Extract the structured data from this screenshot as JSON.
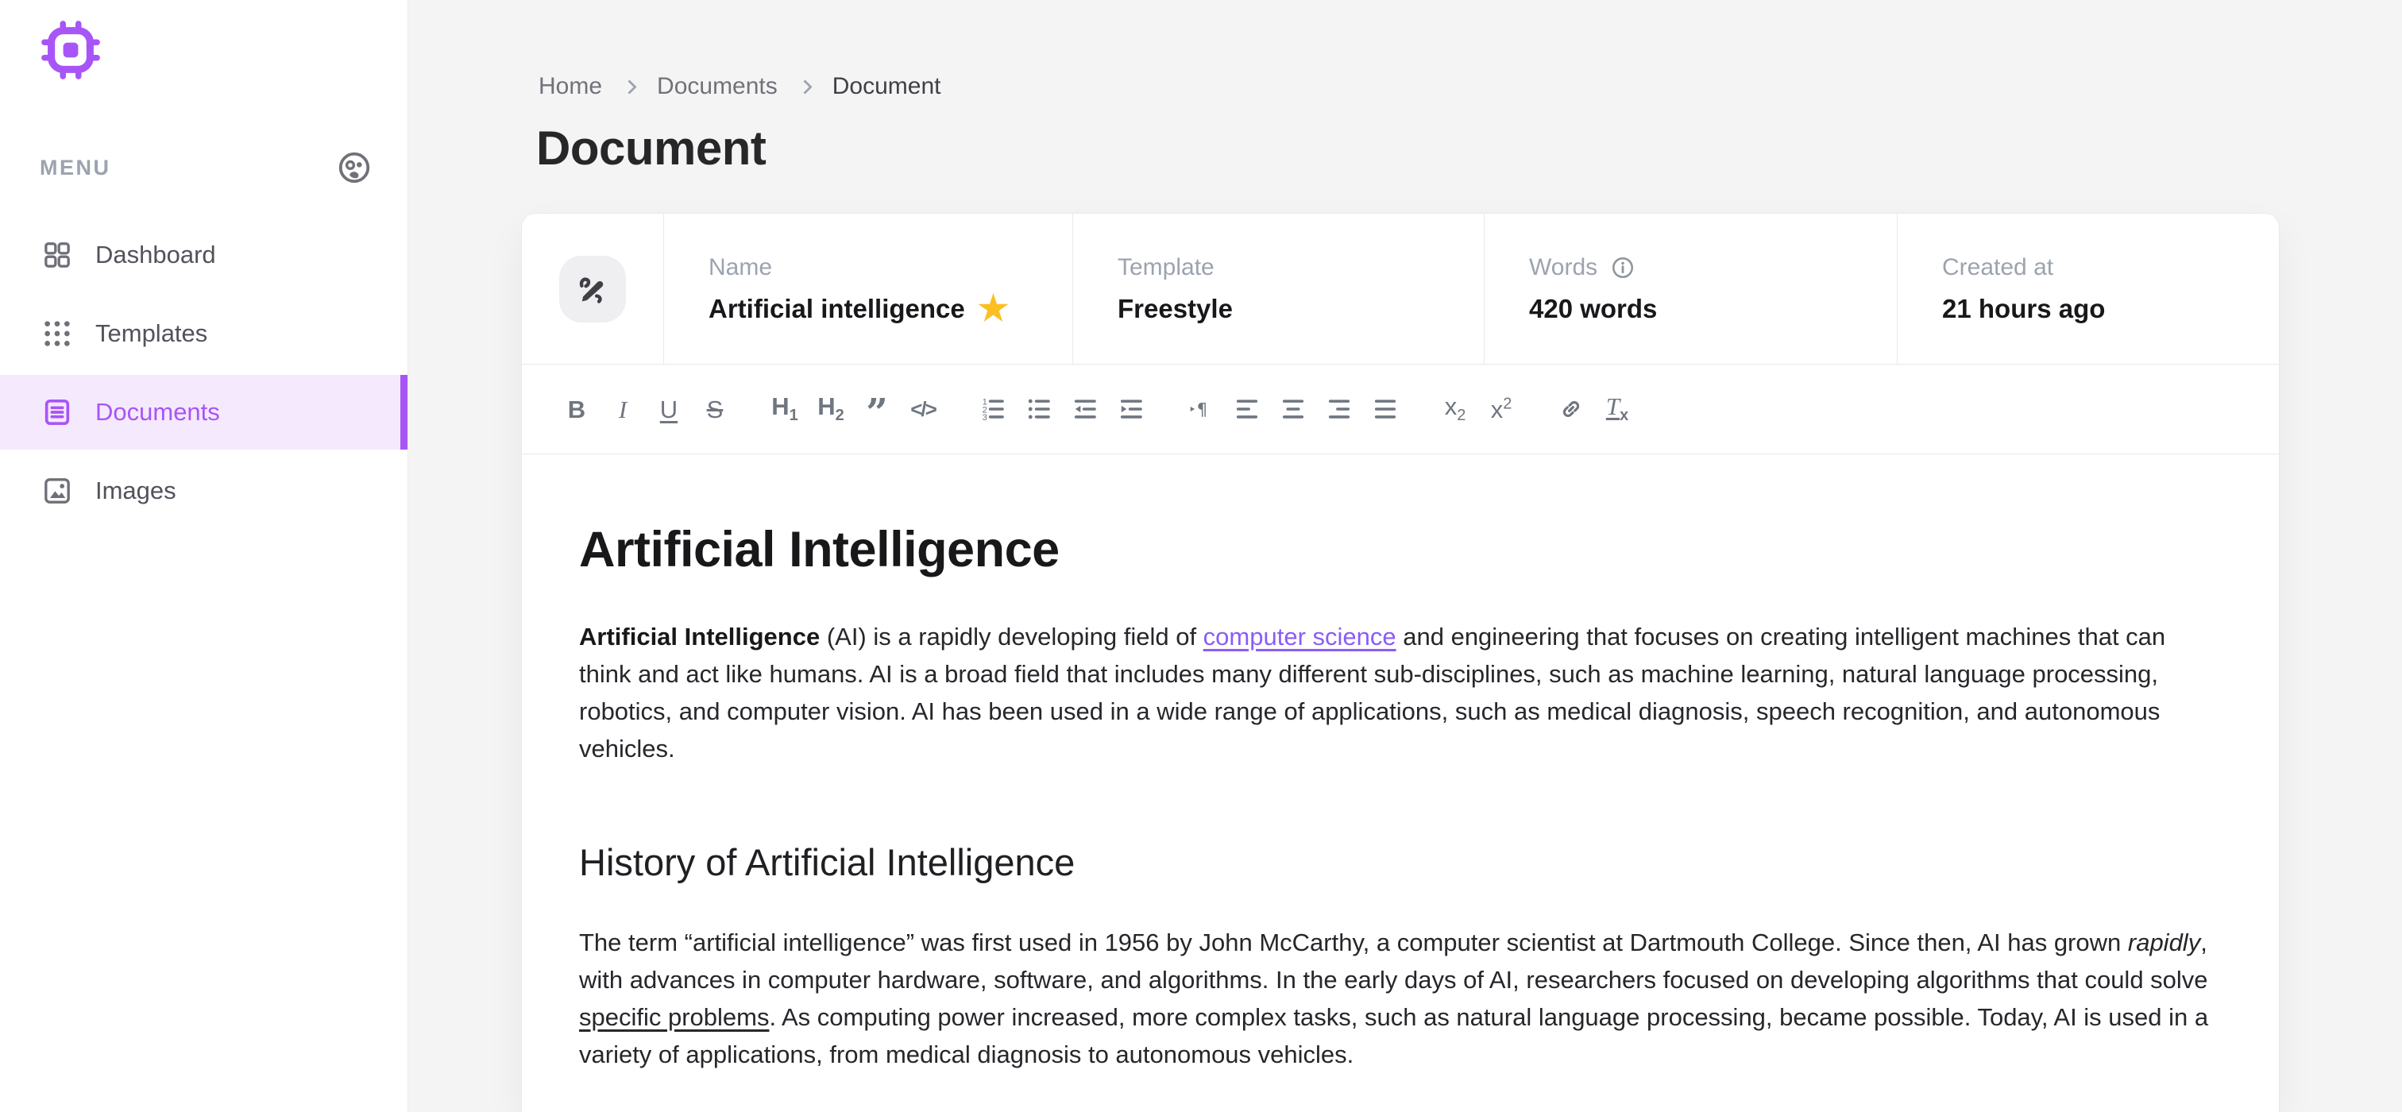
{
  "colors": {
    "accent": "#a855f7",
    "link": "#8b5cf6",
    "star": "#fbbf24",
    "active_item_bg": "#f5e9fd",
    "page_bg": "#f4f4f5"
  },
  "sidebar": {
    "menu_label": "MENU",
    "items": [
      {
        "label": "Dashboard",
        "icon": "dashboard-icon",
        "active": false
      },
      {
        "label": "Templates",
        "icon": "templates-icon",
        "active": false
      },
      {
        "label": "Documents",
        "icon": "documents-icon",
        "active": true
      },
      {
        "label": "Images",
        "icon": "images-icon",
        "active": false
      }
    ]
  },
  "header": {
    "breadcrumb": [
      {
        "label": "Home"
      },
      {
        "label": "Documents"
      },
      {
        "label": "Document"
      }
    ],
    "title": "Document",
    "actions": [
      "save-icon",
      "copy-icon",
      "more-icon"
    ]
  },
  "meta": {
    "fields": [
      {
        "label": "Name",
        "value": "Artificial intelligence",
        "starred": true
      },
      {
        "label": "Template",
        "value": "Freestyle"
      },
      {
        "label": "Words",
        "value": "420 words",
        "info": true
      },
      {
        "label": "Created at",
        "value": "21 hours ago"
      }
    ],
    "star_glyph": "★"
  },
  "toolbar": {
    "groups": [
      [
        "bold-icon",
        "italic-icon",
        "underline-icon",
        "strikethrough-icon"
      ],
      [
        "heading1-icon",
        "heading2-icon",
        "blockquote-icon",
        "code-icon"
      ],
      [
        "ordered-list-icon",
        "unordered-list-icon",
        "outdent-icon",
        "indent-icon"
      ],
      [
        "text-direction-icon",
        "align-left-icon",
        "align-center-icon",
        "align-right-icon",
        "align-justify-icon"
      ],
      [
        "subscript-icon",
        "superscript-icon"
      ],
      [
        "link-icon",
        "clear-format-icon"
      ]
    ]
  },
  "editor": {
    "heading1": "Artificial Intelligence",
    "paragraph1": [
      {
        "t": "Artificial Intelligence",
        "b": true
      },
      {
        "t": " (AI) is a rapidly developing field of "
      },
      {
        "t": "computer science",
        "link": true
      },
      {
        "t": " and engineering that focuses on creating intelligent machines that can think and act like humans. AI is a broad field that includes many different sub-disciplines, such as machine learning, natural language processing, robotics, and computer vision. AI has been used in a wide range of applications, such as medical diagnosis, speech recognition, and autonomous vehicles."
      }
    ],
    "heading2": "History of Artificial Intelligence",
    "paragraph2": [
      {
        "t": "The term “artificial intelligence” was first used in 1956 by John McCarthy, a computer scientist at Dartmouth College. Since then, AI has grown "
      },
      {
        "t": "rapidly",
        "i": true
      },
      {
        "t": ", with advances in computer hardware, software, and algorithms. In the early days of AI, researchers focused on developing algorithms that could solve "
      },
      {
        "t": "specific problems",
        "u": true
      },
      {
        "t": ". As computing power increased, more complex tasks, such as natural language processing, became possible. Today, AI is used in a variety of applications, from medical diagnosis to autonomous vehicles."
      }
    ]
  }
}
